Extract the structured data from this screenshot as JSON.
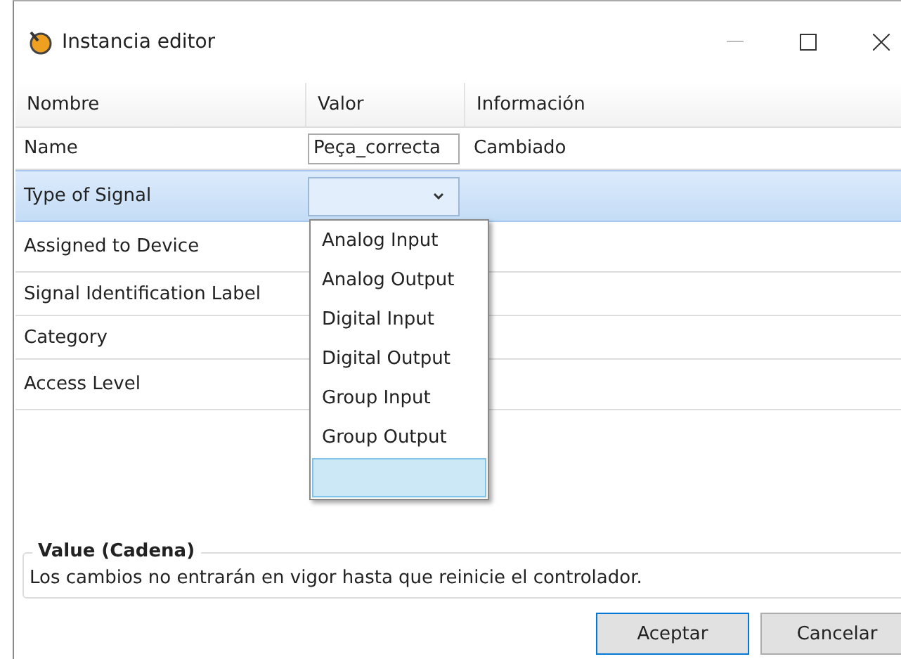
{
  "window": {
    "title": "Instancia editor"
  },
  "table": {
    "columns": [
      "Nombre",
      "Valor",
      "Información"
    ],
    "rows": [
      {
        "name": "Name",
        "kind": "input",
        "value": "Peça_correcta",
        "info": "Cambiado",
        "selected": false
      },
      {
        "name": "Type of Signal",
        "kind": "select",
        "selected": true
      },
      {
        "name": "Assigned to Device",
        "kind": "text",
        "selected": false
      },
      {
        "name": "Signal Identification Label",
        "kind": "text",
        "selected": false
      },
      {
        "name": "Category",
        "kind": "text",
        "selected": false
      },
      {
        "name": "Access Level",
        "kind": "text",
        "selected": false
      }
    ]
  },
  "dropdown": {
    "options": [
      {
        "label": "Analog Input",
        "selected": false
      },
      {
        "label": "Analog Output",
        "selected": false
      },
      {
        "label": "Digital Input",
        "selected": false
      },
      {
        "label": "Digital Output",
        "selected": false
      },
      {
        "label": "Group Input",
        "selected": false
      },
      {
        "label": "Group Output",
        "selected": false
      }
    ],
    "blank_option_highlighted": true
  },
  "info_group": {
    "title": "Value (Cadena)",
    "text": "Los cambios no entrarán en vigor hasta que reinicie el controlador."
  },
  "buttons": [
    {
      "label": "Aceptar",
      "default": true
    },
    {
      "label": "Cancelar",
      "default": false
    }
  ]
}
